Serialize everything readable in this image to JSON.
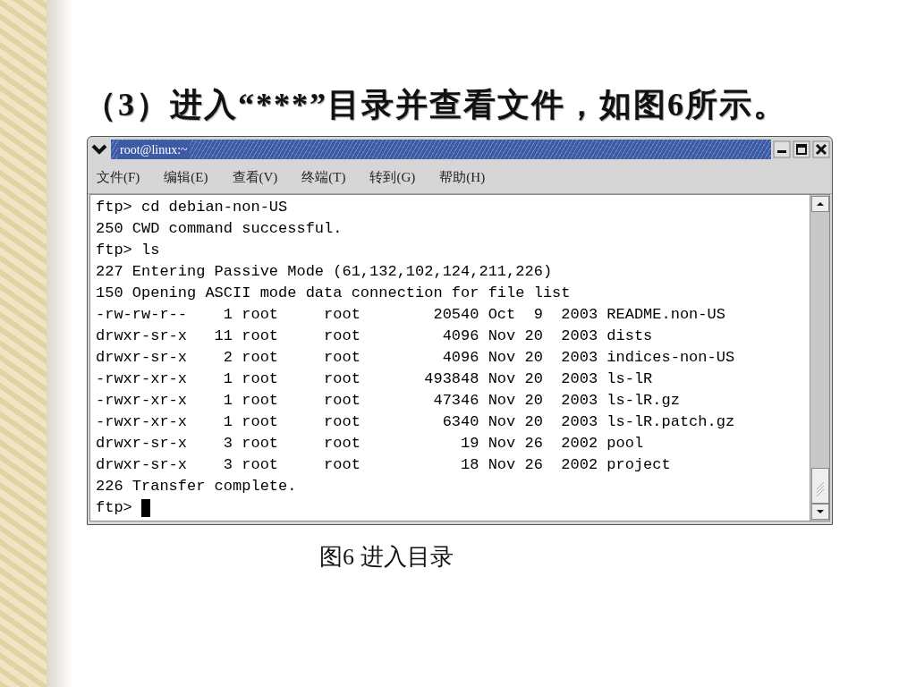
{
  "slide": {
    "title": "（3）进入“***”目录并查看文件，如图6所示。",
    "caption": "图6  进入目录"
  },
  "window": {
    "title": "root@linux:~"
  },
  "menu": [
    "文件(F)",
    "编辑(E)",
    "查看(V)",
    "终端(T)",
    "转到(G)",
    "帮助(H)"
  ],
  "terminal": {
    "lines": [
      "ftp> cd debian-non-US",
      "250 CWD command successful.",
      "ftp> ls",
      "227 Entering Passive Mode (61,132,102,124,211,226)",
      "150 Opening ASCII mode data connection for file list",
      "-rw-rw-r--    1 root     root        20540 Oct  9  2003 README.non-US",
      "drwxr-sr-x   11 root     root         4096 Nov 20  2003 dists",
      "drwxr-sr-x    2 root     root         4096 Nov 20  2003 indices-non-US",
      "-rwxr-xr-x    1 root     root       493848 Nov 20  2003 ls-lR",
      "-rwxr-xr-x    1 root     root        47346 Nov 20  2003 ls-lR.gz",
      "-rwxr-xr-x    1 root     root         6340 Nov 20  2003 ls-lR.patch.gz",
      "drwxr-sr-x    3 root     root           19 Nov 26  2002 pool",
      "drwxr-sr-x    3 root     root           18 Nov 26  2002 project",
      "226 Transfer complete."
    ],
    "prompt": "ftp>"
  }
}
